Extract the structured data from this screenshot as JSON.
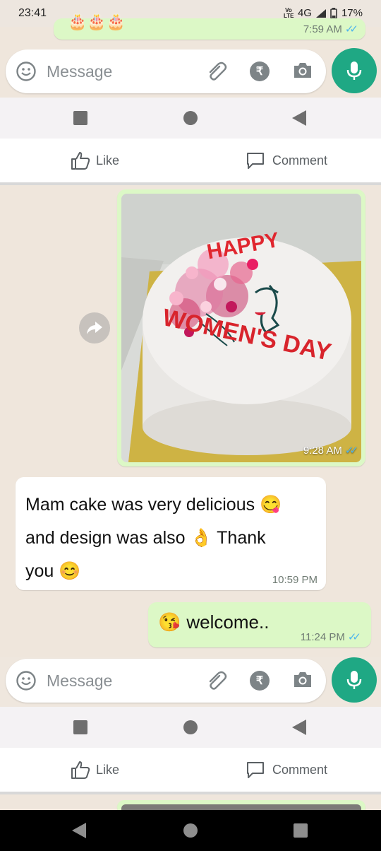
{
  "status_bar": {
    "time": "23:41",
    "network": "4G",
    "volte": "Vo LTE",
    "battery": "17%"
  },
  "top_partial_message": {
    "time": "7:59 AM"
  },
  "input": {
    "placeholder": "Message",
    "rupee_symbol": "₹"
  },
  "like_bar": {
    "like_label": "Like",
    "comment_label": "Comment"
  },
  "messages": [
    {
      "type": "image",
      "direction": "out",
      "time": "9:28 AM",
      "status": "read",
      "cake_text_top": "HAPPY",
      "cake_text_bottom": "WOMEN'S DAY"
    },
    {
      "type": "text",
      "direction": "in",
      "line1": "Mam cake was very delicious",
      "line1_emoji": "😋",
      "line2": "and design was also",
      "line2_emoji": "👌",
      "line2_tail": "Thank",
      "line3": "you",
      "line3_emoji": "😊",
      "time": "10:59 PM"
    },
    {
      "type": "text",
      "direction": "out",
      "emoji": "😘",
      "text": "welcome..",
      "time": "11:24 PM",
      "status": "read"
    }
  ],
  "icons": [
    "emoji-icon",
    "attach-icon",
    "rupee-icon",
    "camera-icon",
    "mic-icon",
    "square-nav-icon",
    "circle-nav-icon",
    "back-nav-icon",
    "forward-icon",
    "like-icon",
    "comment-icon"
  ],
  "colors": {
    "accent_green": "#1fa884",
    "outgoing_bubble": "#dcf8c6",
    "read_ticks": "#4fb6ec"
  }
}
